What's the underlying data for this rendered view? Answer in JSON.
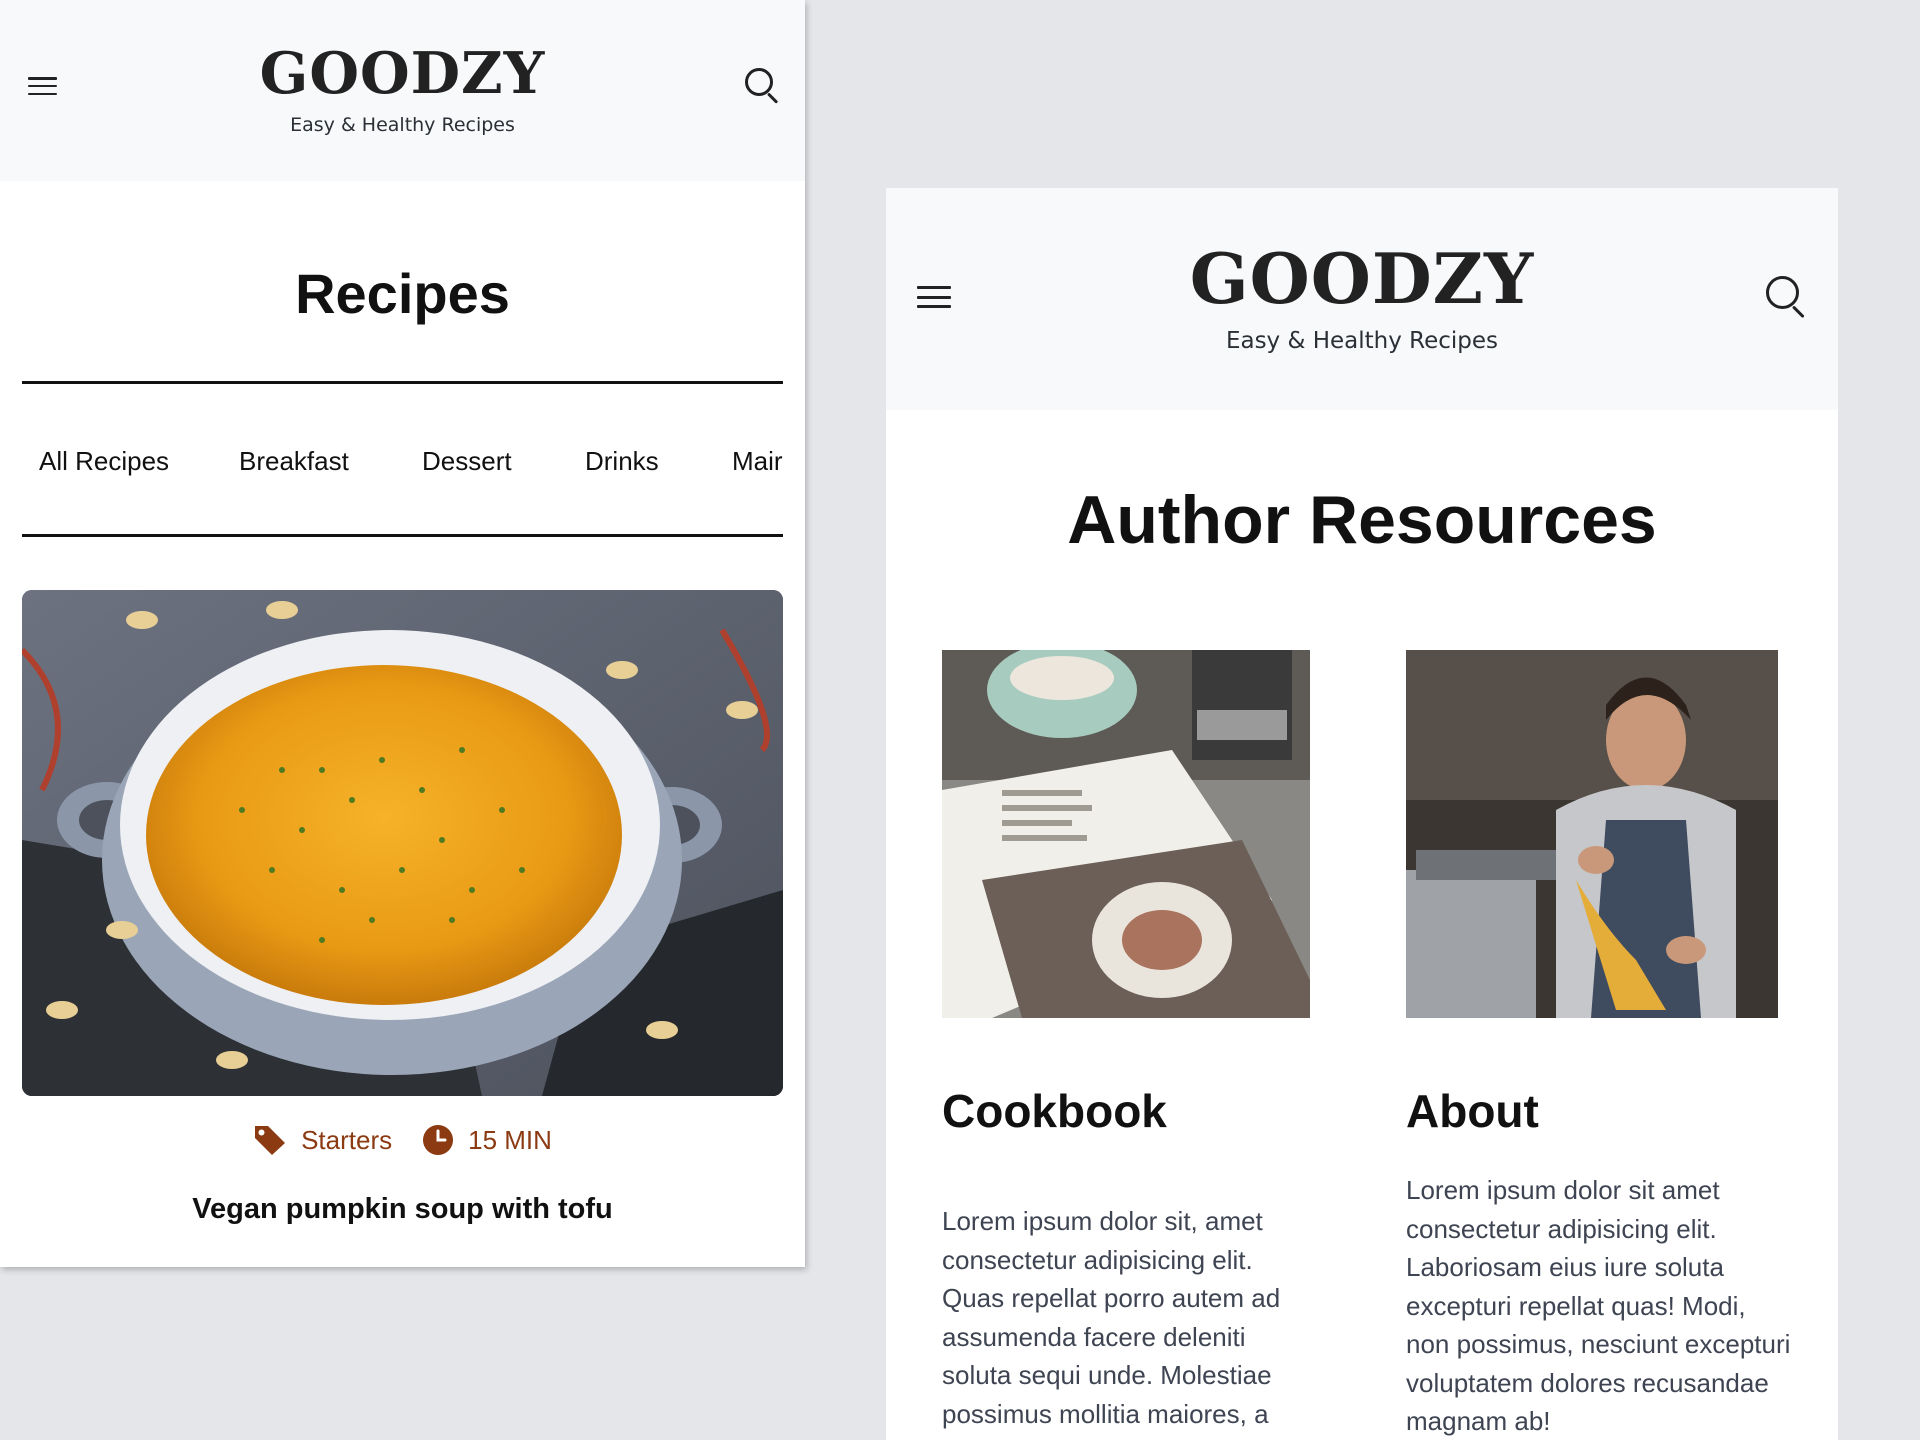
{
  "colors": {
    "page_background": "#e4e6ea",
    "header_background": "#f8f9fb",
    "accent": "#8b3a12",
    "text_dark": "#111111",
    "text_body": "#3e4452"
  },
  "mobile": {
    "header": {
      "logo": "GOODZY",
      "tagline": "Easy & Healthy Recipes",
      "menu_icon": "hamburger-icon",
      "search_icon": "search-icon"
    },
    "page_title": "Recipes",
    "tabs": [
      {
        "label": "All Recipes"
      },
      {
        "label": "Breakfast"
      },
      {
        "label": "Dessert"
      },
      {
        "label": "Drinks"
      },
      {
        "label": "Mair"
      }
    ],
    "recipe": {
      "image_alt": "Bowl of pumpkin soup",
      "category_icon": "tag-icon",
      "category": "Starters",
      "time_icon": "clock-icon",
      "time": "15 MIN",
      "title": "Vegan pumpkin soup with tofu"
    }
  },
  "tablet": {
    "header": {
      "logo": "GOODZY",
      "tagline": "Easy & Healthy Recipes",
      "menu_icon": "hamburger-icon",
      "search_icon": "search-icon"
    },
    "page_title": "Author Resources",
    "cards": [
      {
        "image_alt": "Open cookbook on kitchen table",
        "heading": "Cookbook",
        "body": "Lorem ipsum dolor sit, amet consectetur adipisicing elit. Quas repellat porro autem ad assumenda facere deleniti soluta sequi unde. Molestiae possimus mollitia maiores, a"
      },
      {
        "image_alt": "Chef making pasta",
        "heading": "About",
        "body": "Lorem ipsum dolor sit amet consectetur adipisicing elit. Laboriosam eius iure soluta excepturi repellat quas! Modi, non possimus, nesciunt excepturi voluptatem dolores recusandae magnam ab!"
      }
    ]
  }
}
